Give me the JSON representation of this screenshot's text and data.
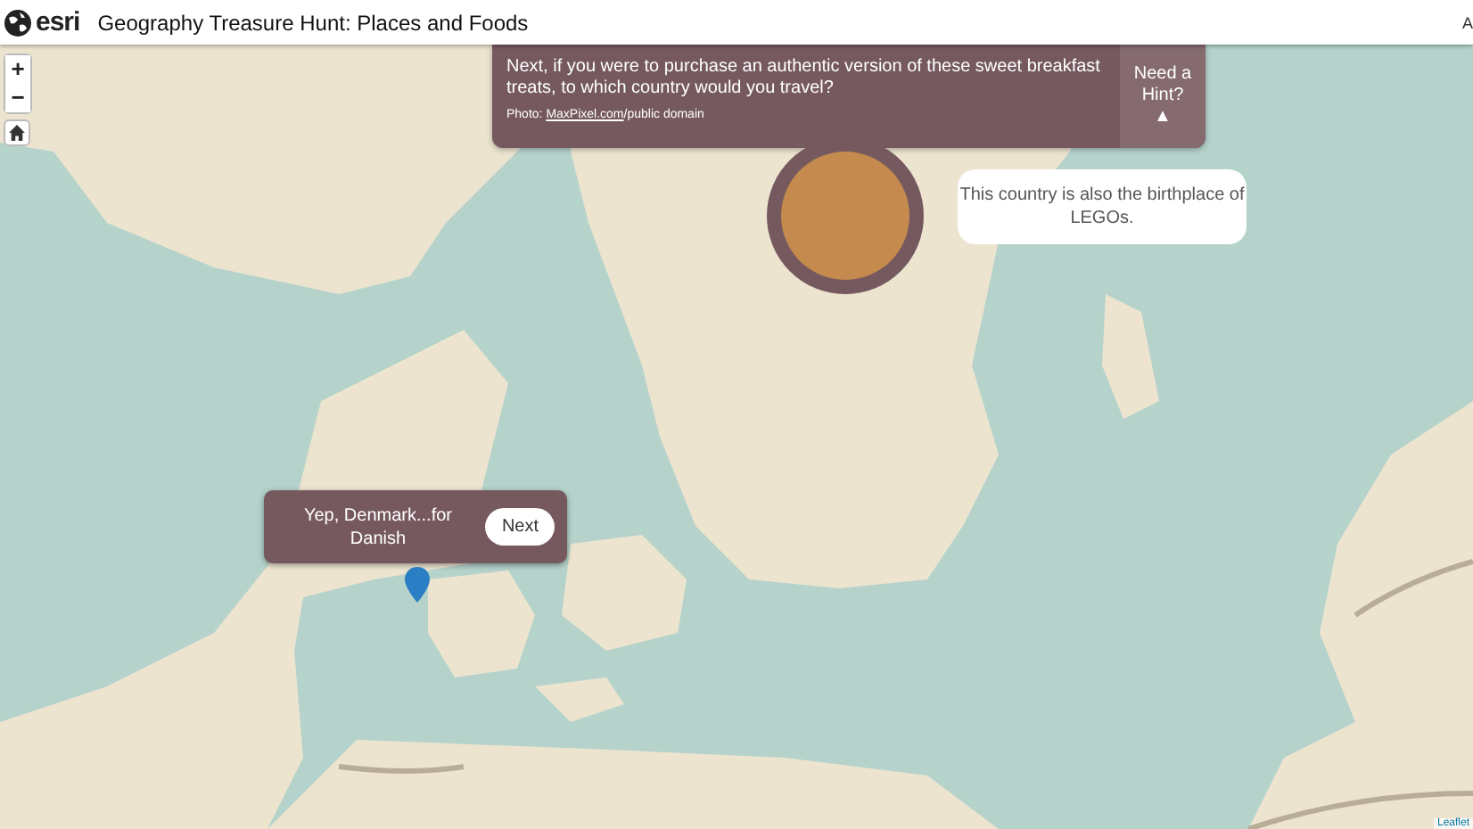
{
  "header": {
    "logo_text": "esri",
    "title": "Geography Treasure Hunt: Places and Foods",
    "edge_text": "A"
  },
  "zoom_controls": {
    "zoom_in": "+",
    "zoom_out": "−"
  },
  "question": {
    "text": "Next, if you were to purchase an authentic version of these sweet breakfast treats, to which country would you travel?",
    "credit_prefix": "Photo: ",
    "credit_link": "MaxPixel.com",
    "credit_suffix": "/public domain",
    "hint_label": "Need a Hint?",
    "hint_arrow": "▲"
  },
  "hint_bubble": {
    "text": "This country is also the birthplace of LEGOs."
  },
  "answer": {
    "text": "Yep, Denmark...for Danish",
    "next_button": "Next"
  },
  "attribution": "Leaflet"
}
